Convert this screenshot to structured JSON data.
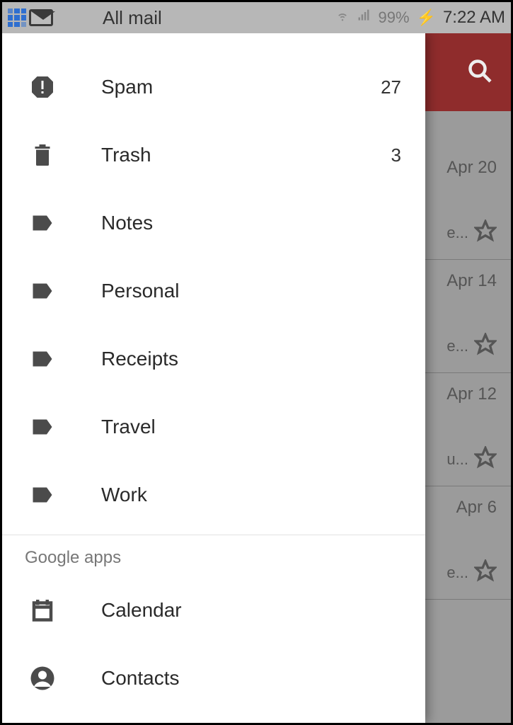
{
  "status_bar": {
    "title": "All mail",
    "battery": "99%",
    "time": "7:22 AM"
  },
  "drawer": {
    "folders": [
      {
        "icon": "spam",
        "label": "Spam",
        "count": "27"
      },
      {
        "icon": "trash",
        "label": "Trash",
        "count": "3"
      },
      {
        "icon": "label",
        "label": "Notes",
        "count": ""
      },
      {
        "icon": "label",
        "label": "Personal",
        "count": ""
      },
      {
        "icon": "label",
        "label": "Receipts",
        "count": ""
      },
      {
        "icon": "label",
        "label": "Travel",
        "count": ""
      },
      {
        "icon": "label",
        "label": "Work",
        "count": ""
      }
    ],
    "section_header": "Google apps",
    "apps": [
      {
        "icon": "calendar",
        "label": "Calendar"
      },
      {
        "icon": "contacts",
        "label": "Contacts"
      }
    ]
  },
  "behind": {
    "rows": [
      {
        "date": "Apr 20",
        "snippet": "e..."
      },
      {
        "date": "Apr 14",
        "snippet": "e..."
      },
      {
        "date": "Apr 12",
        "snippet": "u..."
      },
      {
        "date": "Apr 6",
        "snippet": "e..."
      }
    ]
  }
}
